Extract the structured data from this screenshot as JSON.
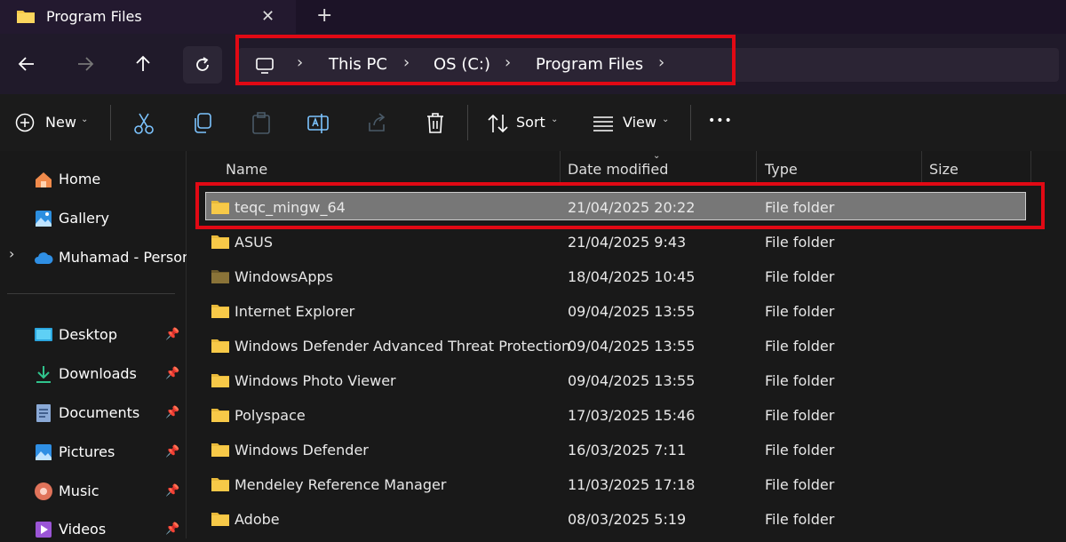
{
  "window": {
    "tab_title": "Program Files",
    "close_glyph": "✕",
    "add_glyph": "+"
  },
  "navigation": {
    "back_icon": "arrow-left-icon",
    "forward_icon": "arrow-right-icon",
    "up_icon": "arrow-up-icon",
    "refresh_icon": "refresh-icon"
  },
  "address": {
    "crumbs": [
      "This PC",
      "OS (C:)",
      "Program Files"
    ],
    "separator": "›"
  },
  "toolbar": {
    "new_label": "New",
    "sort_label": "Sort",
    "view_label": "View",
    "more_glyph": "•••",
    "dropdown_glyph": "⌄"
  },
  "sidebar": {
    "home": "Home",
    "gallery": "Gallery",
    "onedrive": "Muhamad - Persona",
    "expand_glyph": "›",
    "pin_glyph": "📌",
    "quick_access": [
      "Desktop",
      "Downloads",
      "Documents",
      "Pictures",
      "Music",
      "Videos"
    ]
  },
  "columns": {
    "name": "Name",
    "date": "Date modified",
    "type": "Type",
    "size": "Size"
  },
  "files": [
    {
      "name": "teqc_mingw_64",
      "date": "21/04/2025 20:22",
      "type": "File folder"
    },
    {
      "name": "ASUS",
      "date": "21/04/2025 9:43",
      "type": "File folder"
    },
    {
      "name": "WindowsApps",
      "date": "18/04/2025 10:45",
      "type": "File folder"
    },
    {
      "name": "Internet Explorer",
      "date": "09/04/2025 13:55",
      "type": "File folder"
    },
    {
      "name": "Windows Defender Advanced Threat Protection",
      "date": "09/04/2025 13:55",
      "type": "File folder"
    },
    {
      "name": "Windows Photo Viewer",
      "date": "09/04/2025 13:55",
      "type": "File folder"
    },
    {
      "name": "Polyspace",
      "date": "17/03/2025 15:46",
      "type": "File folder"
    },
    {
      "name": "Windows Defender",
      "date": "16/03/2025 7:11",
      "type": "File folder"
    },
    {
      "name": "Mendeley Reference Manager",
      "date": "11/03/2025 17:18",
      "type": "File folder"
    },
    {
      "name": "Adobe",
      "date": "08/03/2025 5:19",
      "type": "File folder"
    }
  ],
  "colors": {
    "accent_highlight": "#e10914",
    "folder": "#f7c948",
    "folder_dark": "#8a7338"
  }
}
